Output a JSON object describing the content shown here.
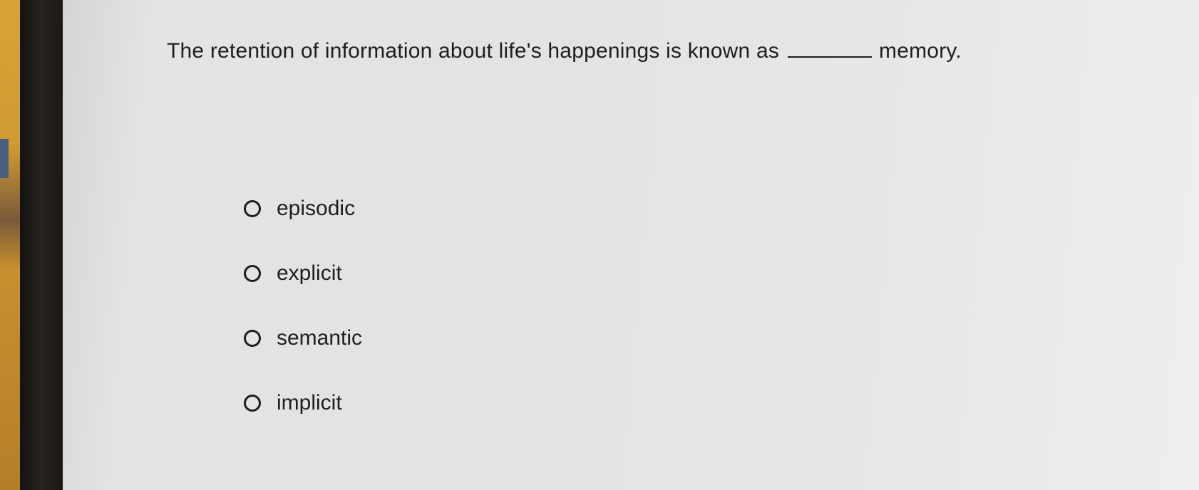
{
  "question": {
    "text_before": "The retention of information about life's happenings is known as",
    "text_after": "memory."
  },
  "options": [
    {
      "label": "episodic"
    },
    {
      "label": "explicit"
    },
    {
      "label": "semantic"
    },
    {
      "label": "implicit"
    }
  ]
}
